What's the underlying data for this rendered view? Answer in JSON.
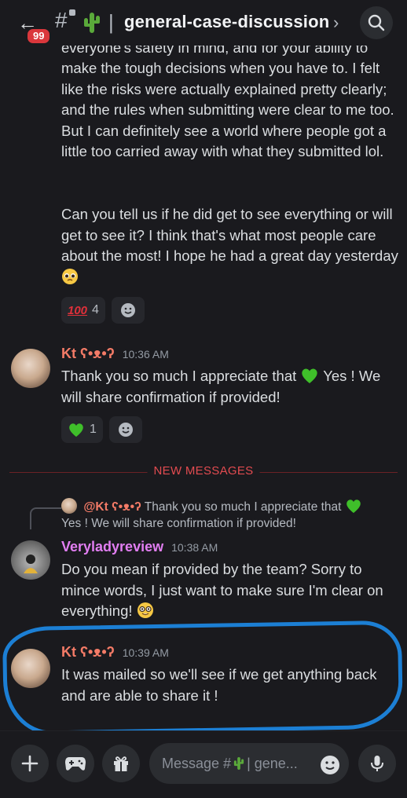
{
  "header": {
    "unread_badge": "99",
    "channel_name": "general-case-discussion",
    "separator": "|"
  },
  "messages": {
    "partial_top": "everyone's safety in mind, and for your ability to",
    "cont_para1": "make the tough decisions when you have to. I felt like the risks were actually explained pretty clearly; and the rules when submitting were clear to me too. But I can definitely see a world where people got a little too carried away with what they submitted lol.",
    "cont_para2": "Can you tell us if he did get to see everything or will get to see it? I think that's what most people care about the most! I hope he had a great day yesterday",
    "cont_reaction_count": "4",
    "msg1": {
      "author": "Kt ʕ•ᴥ•ʔ",
      "author_color": "#f47b67",
      "time": "10:36 AM",
      "text_a": "Thank you so much I appreciate that",
      "text_b": "Yes ! We will share confirmation if provided!",
      "reaction_count": "1"
    },
    "divider_label": "NEW MESSAGES",
    "reply": {
      "author": "@Kt ʕ•ᴥ•ʔ",
      "text_a": "Thank you so much I appreciate that",
      "text_b": "Yes ! We will share confirmation if provided!"
    },
    "msg2": {
      "author": "Verylady​review",
      "author_display": "Veryladyreview",
      "author_color": "#e27ef2",
      "time": "10:38 AM",
      "text": "Do you mean if provided by the team? Sorry to mince words, I just want to make sure I'm clear on everything!"
    },
    "msg3": {
      "author": "Kt ʕ•ᴥ•ʔ",
      "author_color": "#f47b67",
      "time": "10:39 AM",
      "text": "It was mailed so we'll see if we get anything back and are able to share it !"
    }
  },
  "composer": {
    "placeholder_prefix": "Message #",
    "placeholder_suffix": " | gene..."
  },
  "colors": {
    "background": "#1a1a1e",
    "badge": "#da373c",
    "divider": "#e24b50",
    "highlight_ring": "#1c7fd4"
  },
  "icons": [
    "back-arrow-icon",
    "hash-icon",
    "cactus-icon",
    "chevron-right-icon",
    "search-icon",
    "hundred-points-icon",
    "pleading-face-icon",
    "add-reaction-icon",
    "green-heart-icon",
    "nerd-face-icon",
    "plus-icon",
    "gamepad-icon",
    "gift-icon",
    "emoji-icon",
    "microphone-icon"
  ]
}
